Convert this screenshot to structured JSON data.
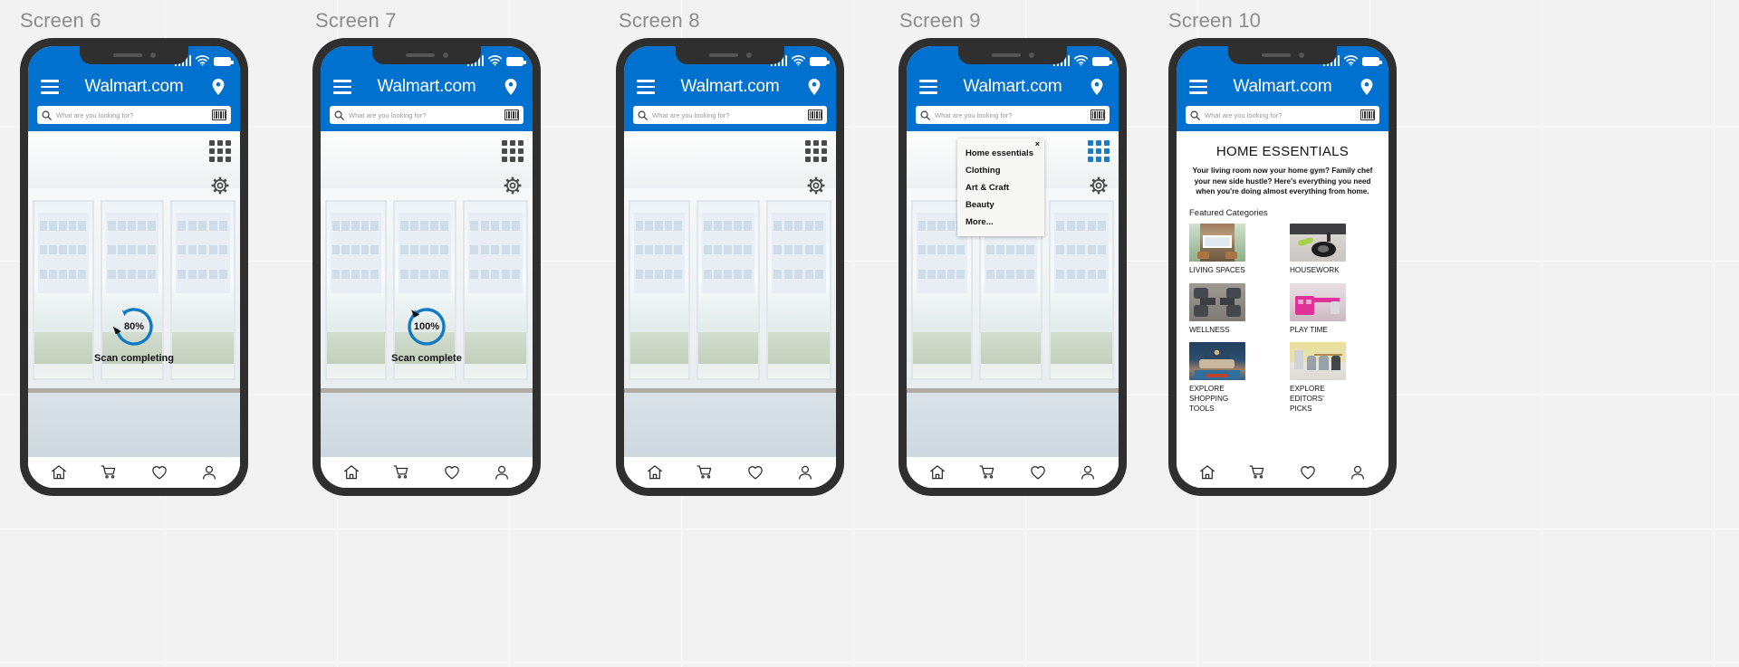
{
  "artboard": {
    "labels": [
      "Screen 6",
      "Screen 7",
      "Screen 8",
      "Screen 9",
      "Screen 10"
    ]
  },
  "colors": {
    "brand_blue": "#0071ce",
    "phone_frame": "#2f2f2f",
    "label_gray": "#8c8c8c",
    "grid_icon_blue": "#1a7bc4",
    "scan_arc_blue": "#1279c4"
  },
  "phone_ui": {
    "brand_name": "Walmart.com",
    "search_placeholder": "What are you looking for?",
    "icons": {
      "menu": "hamburger-icon",
      "location": "location-pin-icon",
      "search": "search-icon",
      "barcode": "barcode-scan-icon",
      "grid": "grid-apps-icon",
      "settings": "gear-icon",
      "signal": "signal-bars-icon",
      "wifi": "wifi-icon",
      "battery": "battery-icon"
    },
    "bottom_nav": [
      {
        "name": "home",
        "icon": "home-icon"
      },
      {
        "name": "cart",
        "icon": "shopping-cart-icon"
      },
      {
        "name": "favorites",
        "icon": "heart-icon"
      },
      {
        "name": "account",
        "icon": "person-icon"
      }
    ]
  },
  "screens": [
    {
      "id": "screen-6",
      "label": "Screen 6",
      "type": "camera-scan",
      "scan": {
        "percent": "80%",
        "status": "Scan completing",
        "arc_sweep": 288
      }
    },
    {
      "id": "screen-7",
      "label": "Screen 7",
      "type": "camera-scan",
      "scan": {
        "percent": "100%",
        "status": "Scan complete",
        "arc_sweep": 350
      }
    },
    {
      "id": "screen-8",
      "label": "Screen 8",
      "type": "camera-plain"
    },
    {
      "id": "screen-9",
      "label": "Screen 9",
      "type": "camera-dropdown",
      "dropdown": {
        "close_label": "×",
        "items": [
          "Home essentials",
          "Clothing",
          "Art & Craft",
          "Beauty",
          "More..."
        ]
      }
    },
    {
      "id": "screen-10",
      "label": "Screen 10",
      "type": "home-essentials",
      "page": {
        "title": "HOME ESSENTIALS",
        "subtitle": "Your living room now your home gym? Family chef your new side hustle? Here's everything you need when you're doing almost everything from home.",
        "featured_heading": "Featured Categories",
        "categories": [
          {
            "caption": "LIVING SPACES",
            "thumb": "living-room-fireplace"
          },
          {
            "caption": "HOUSEWORK",
            "thumb": "robot-vacuum"
          },
          {
            "caption": "WELLNESS",
            "thumb": "dumbbells"
          },
          {
            "caption": "PLAY TIME",
            "thumb": "pink-kids-desk"
          },
          {
            "caption": "EXPLORE\nSHOPPING\nTOOLS",
            "thumb": "blue-living-room"
          },
          {
            "caption": "EXPLORE\nEDITORS'\nPICKS",
            "thumb": "office-chairs"
          }
        ]
      }
    }
  ]
}
